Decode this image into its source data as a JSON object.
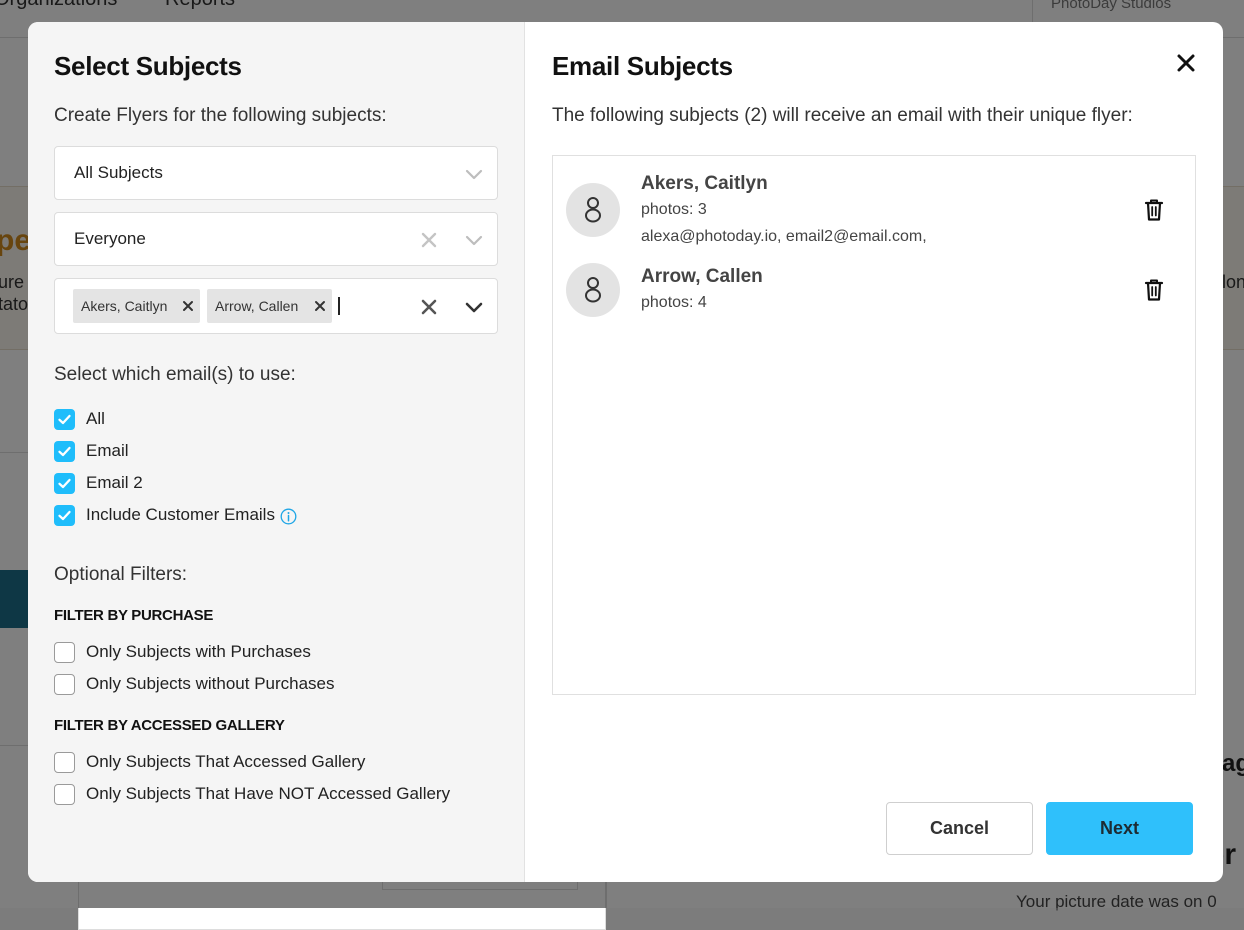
{
  "background": {
    "nav": [
      "Organizations",
      "Reports"
    ],
    "studio_name": "PhotoDay Studios",
    "band_title": "pe",
    "fragments_left": [
      "ure",
      "tato"
    ],
    "fragment_right_mid": "lon",
    "fragment_right_lower": "age",
    "fragment_right_bottom": "pr",
    "bottom_text": "Your picture date was on 0"
  },
  "left": {
    "title": "Select Subjects",
    "subtitle": "Create Flyers for the following subjects:",
    "select_scope": {
      "value": "All Subjects"
    },
    "select_group": {
      "value": "Everyone"
    },
    "select_subjects": {
      "chips": [
        "Akers, Caitlyn",
        "Arrow, Callen"
      ]
    },
    "email_section_label": "Select which email(s) to use:",
    "email_options": [
      {
        "label": "All",
        "checked": true
      },
      {
        "label": "Email",
        "checked": true
      },
      {
        "label": "Email 2",
        "checked": true
      },
      {
        "label": "Include Customer Emails",
        "checked": true
      }
    ],
    "optional_filters_label": "Optional Filters:",
    "filter_purchase": {
      "heading": "FILTER BY PURCHASE",
      "options": [
        {
          "label": "Only Subjects with Purchases",
          "checked": false
        },
        {
          "label": "Only Subjects without Purchases",
          "checked": false
        }
      ]
    },
    "filter_gallery": {
      "heading": "FILTER BY ACCESSED GALLERY",
      "options": [
        {
          "label": "Only Subjects That Accessed Gallery",
          "checked": false
        },
        {
          "label": "Only Subjects That Have NOT Accessed Gallery",
          "checked": false
        }
      ]
    }
  },
  "right": {
    "title": "Email Subjects",
    "subtitle": "The following subjects (2) will receive an email with their unique flyer:",
    "subjects": [
      {
        "name": "Akers, Caitlyn",
        "photos": "photos: 3",
        "emails": "alexa@photoday.io, email2@email.com,"
      },
      {
        "name": "Arrow, Callen",
        "photos": "photos: 4"
      }
    ],
    "cancel_label": "Cancel",
    "next_label": "Next"
  },
  "colors": {
    "accent": "#2fc0fb",
    "checkbox": "#1fbdfb",
    "left_pane_bg": "#f5f5f5"
  },
  "icons": {
    "close": "close-icon",
    "chevron": "chevron-down-icon",
    "clear": "clear-icon",
    "info": "info-icon",
    "trash": "trash-icon",
    "avatar": "person-icon"
  }
}
